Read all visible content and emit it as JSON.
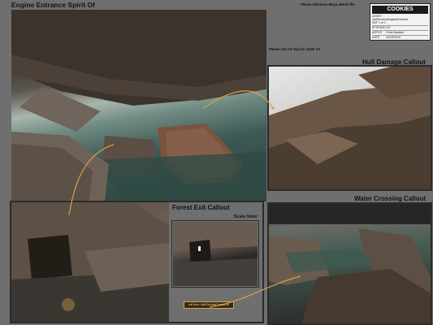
{
  "header": {
    "title": "Engine Entrance Spirit Of",
    "reference_note": "Please reference Moya sketch file",
    "water_note": "Please see CG Sup for water FX"
  },
  "title_block": {
    "logo": "COOKIES",
    "asset_label": "ASSET:",
    "asset_value": "JadiOrculusEngineEntrance",
    "sheet_value": "SDF 1 of 2",
    "episode_label": "EPISODE:",
    "episode_value": "107",
    "artist_label": "ARTIST",
    "artist_value": "Chris Madden",
    "date_label": "DATE",
    "date_value": "10/15/2019"
  },
  "callouts": {
    "hull": "Hull Damage Callout",
    "water": "Water Crossing Callout",
    "forest": "Forest Exit Callout",
    "scale": "Scale Note:"
  },
  "forest_note": "sdf from JadiOrculusForestExit",
  "colors": {
    "background": "#6f6f6f",
    "callout_line": "#d9a040",
    "frame": "#2b2b2b"
  }
}
